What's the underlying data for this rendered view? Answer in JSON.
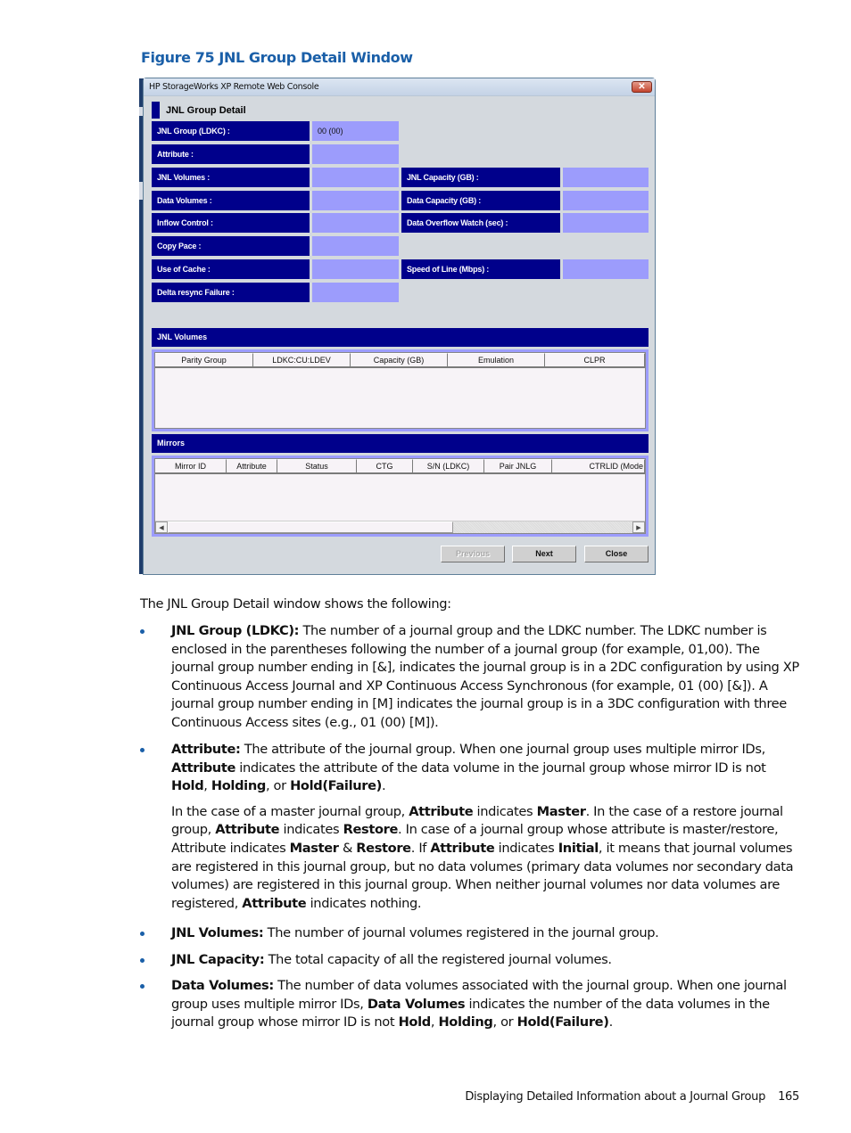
{
  "figure": {
    "caption": "Figure 75 JNL Group Detail Window"
  },
  "window": {
    "title": "HP StorageWorks XP Remote Web Console",
    "close_label": "x",
    "panel_title": "JNL Group Detail",
    "fields_left": [
      {
        "label": "JNL Group (LDKC) :",
        "value": "00 (00)"
      },
      {
        "label": "Attribute :",
        "value": ""
      },
      {
        "label": "JNL Volumes :",
        "value": ""
      },
      {
        "label": "Data Volumes :",
        "value": ""
      },
      {
        "label": "Inflow Control :",
        "value": ""
      },
      {
        "label": "Copy Pace :",
        "value": ""
      },
      {
        "label": "Use of Cache :",
        "value": ""
      },
      {
        "label": "Delta resync Failure :",
        "value": ""
      }
    ],
    "fields_right": [
      {
        "label": "JNL Capacity (GB) :",
        "value": ""
      },
      {
        "label": "Data Capacity (GB) :",
        "value": ""
      },
      {
        "label": "Data Overflow Watch (sec) :",
        "value": ""
      },
      {
        "label": "Speed of Line (Mbps) :",
        "value": ""
      }
    ],
    "jnl_volumes": {
      "title": "JNL Volumes",
      "columns": [
        "Parity Group",
        "LDKC:CU:LDEV",
        "Capacity (GB)",
        "Emulation",
        "CLPR"
      ],
      "rows": []
    },
    "mirrors": {
      "title": "Mirrors",
      "columns": [
        "Mirror ID",
        "Attribute",
        "Status",
        "CTG",
        "S/N (LDKC)",
        "Pair JNLG",
        "CTRLID (Mode"
      ],
      "rows": []
    },
    "buttons": {
      "previous": "Previous",
      "next": "Next",
      "close": "Close"
    }
  },
  "document": {
    "intro": "The JNL Group Detail window shows the following:",
    "bullets": [
      {
        "term": "JNL Group (LDKC):",
        "text": " The number of a journal group and the LDKC number. The LDKC number is enclosed in the parentheses following the number of a journal group (for example, 01,00). The journal group number ending in [&], indicates the journal group is in a 2DC configuration by using XP Continuous Access Journal and XP Continuous Access Synchronous (for example, 01 (00) [&]). A journal group number ending in [M] indicates the journal group is in a 3DC configuration with three Continuous Access sites (e.g., 01 (00) [M])."
      },
      {
        "term": "Attribute:",
        "text_a": " The attribute of the journal group. When one journal group uses multiple mirror IDs, ",
        "b1": "Attribute",
        "text_b": " indicates the attribute of the data volume in the journal group whose mirror ID is not ",
        "b2": "Hold",
        "text_c": ", ",
        "b3": "Holding",
        "text_d": ", or ",
        "b4": "Hold(Failure)",
        "text_e": ".",
        "para2": {
          "t1": "In the case of a master journal group, ",
          "b1": "Attribute",
          "t2": " indicates ",
          "b2": "Master",
          "t3": ". In the case of a restore journal group, ",
          "b3": "Attribute",
          "t4": " indicates ",
          "b4": "Restore",
          "t5": ". In case of a journal group whose attribute is master/restore, Attribute indicates ",
          "b5": "Master",
          "t6": " & ",
          "b6": "Restore",
          "t7": ". If ",
          "b7": "Attribute",
          "t8": " indicates ",
          "b8": "Initial",
          "t9": ", it means that journal volumes are registered in this journal group, but no data volumes (primary data volumes nor secondary data volumes) are registered in this journal group. When neither journal volumes nor data volumes are registered, ",
          "b9": "Attribute",
          "t10": " indicates nothing."
        }
      },
      {
        "term": "JNL Volumes:",
        "text": " The number of journal volumes registered in the journal group."
      },
      {
        "term": "JNL Capacity:",
        "text": " The total capacity of all the registered journal volumes."
      },
      {
        "term": "Data Volumes:",
        "text_a": " The number of data volumes associated with the journal group. When one journal group uses multiple mirror IDs, ",
        "b1": "Data Volumes",
        "text_b": " indicates the number of the data volumes in the journal group whose mirror ID is not ",
        "b2": "Hold",
        "text_c": ", ",
        "b3": "Holding",
        "text_d": ", or ",
        "b4": "Hold(Failure)",
        "text_e": "."
      }
    ]
  },
  "footer": {
    "section": "Displaying Detailed Information about a Journal Group",
    "page": "165"
  },
  "colors": {
    "caption_blue": "#1a5fa8",
    "label_navy": "#00008b",
    "value_lavender": "#9c9cfc",
    "window_gray": "#d4d9de"
  }
}
